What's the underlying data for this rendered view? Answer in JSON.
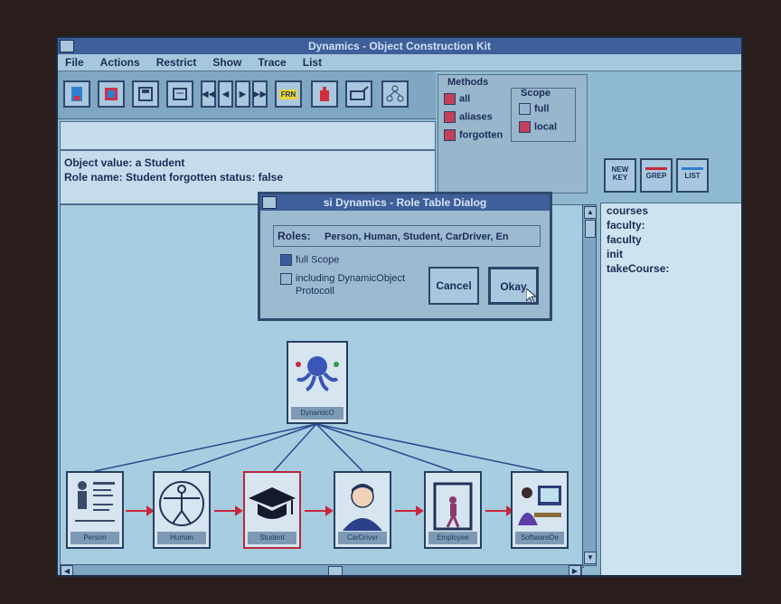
{
  "window": {
    "title": "Dynamics - Object Construction Kit"
  },
  "menu": [
    "File",
    "Actions",
    "Restrict",
    "Show",
    "Trace",
    "List"
  ],
  "toolbar": {
    "tools": [
      "new",
      "open",
      "save",
      "print",
      "nav-first",
      "nav-prev",
      "nav-next",
      "nav-last",
      "run",
      "stop",
      "link",
      "tree"
    ],
    "filter_badge": "FRN"
  },
  "info": {
    "line1": "Object value:  a Student",
    "line2": "Role name:  Student   forgotten status:  false"
  },
  "methods": {
    "title": "Methods",
    "options": [
      {
        "label": "all",
        "checked": false
      },
      {
        "label": "aliases",
        "checked": false
      },
      {
        "label": "forgotten",
        "checked": false
      }
    ],
    "scope": {
      "title": "Scope",
      "options": [
        {
          "label": "full",
          "checked": false
        },
        {
          "label": "local",
          "checked": true
        }
      ]
    }
  },
  "side_buttons": [
    "NEW KEY",
    "GREP",
    "LIST"
  ],
  "right_list": [
    "courses",
    "faculty:",
    "faculty",
    "init",
    "takeCourse:"
  ],
  "dialog": {
    "title": "si Dynamics - Role Table Dialog",
    "roles_label": "Roles:",
    "roles_value": "Person, Human, Student, CarDriver, En",
    "full_scope": "full Scope",
    "including": "including DynamicObject",
    "protocol": "Protocoll",
    "cancel": "Cancel",
    "okay": "Okay"
  },
  "graph": {
    "root": "DynamicO",
    "roles": [
      "Person",
      "Human",
      "Student",
      "CarDriver",
      "Employee",
      "SoftwareDe"
    ]
  },
  "colors": {
    "accent": "#3f5f9a",
    "arrow": "#c8283c",
    "checked": "#c33f5a"
  }
}
